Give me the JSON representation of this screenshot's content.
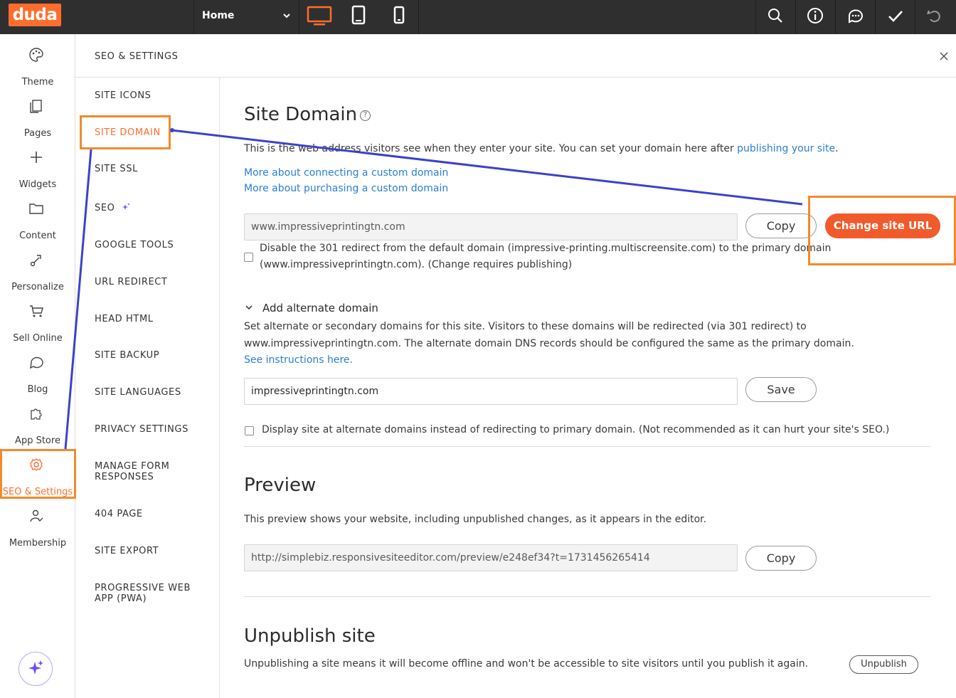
{
  "topbar": {
    "logo": "duda",
    "page_select": "Home",
    "devices": [
      "desktop-icon",
      "tablet-icon",
      "mobile-icon"
    ],
    "actions": [
      "search-icon",
      "info-icon",
      "comments-icon",
      "check-icon",
      "undo-icon"
    ],
    "accent": "#ff6d2d"
  },
  "rail": {
    "items": [
      {
        "label": "Theme",
        "icon": "palette-icon"
      },
      {
        "label": "Pages",
        "icon": "pages-icon"
      },
      {
        "label": "Widgets",
        "icon": "plus-icon"
      },
      {
        "label": "Content",
        "icon": "folder-icon"
      },
      {
        "label": "Personalize",
        "icon": "personalize-icon"
      },
      {
        "label": "Sell Online",
        "icon": "cart-icon"
      },
      {
        "label": "Blog",
        "icon": "chat-bubble-icon"
      },
      {
        "label": "App Store",
        "icon": "puzzle-icon"
      },
      {
        "label": "SEO & Settings",
        "icon": "gear-icon"
      },
      {
        "label": "Membership",
        "icon": "member-icon"
      }
    ],
    "active": "SEO & Settings"
  },
  "panel": {
    "title": "SEO & SETTINGS",
    "nav": [
      "SITE ICONS",
      "SITE DOMAIN",
      "SITE SSL",
      "SEO",
      "GOOGLE TOOLS",
      "URL REDIRECT",
      "HEAD HTML",
      "SITE BACKUP",
      "SITE LANGUAGES",
      "PRIVACY SETTINGS",
      "MANAGE FORM RESPONSES",
      "404 PAGE",
      "SITE EXPORT",
      "PROGRESSIVE WEB APP (PWA)"
    ],
    "active_nav": "SITE DOMAIN"
  },
  "site_domain": {
    "heading": "Site Domain",
    "help": "?",
    "desc": "This is the web address visitors see when they enter your site. You can set your domain here after ",
    "desc_link": "publishing your site",
    "desc_end": ".",
    "link_connect": "More about connecting a custom domain",
    "link_purchase": "More about purchasing a custom domain",
    "domain_value": "www.impressiveprintingtn.com",
    "copy_label": "Copy",
    "change_url_label": "Change site URL",
    "redirect_line1": "Disable the 301 redirect from the default domain (impressive-printing.multiscreensite.com) to the primary domain",
    "redirect_line2": "(www.impressiveprintingtn.com). (Change requires publishing)"
  },
  "alternate": {
    "toggle_label": "Add alternate domain",
    "line1": "Set alternate or secondary domains for this site. Visitors to these domains will be redirected (via 301 redirect) to",
    "line2": "www.impressiveprintingtn.com. The alternate domain DNS records should be configured the same as the primary domain.",
    "instructions_link": "See instructions here.",
    "input_value": "impressiveprintingtn.com",
    "save_label": "Save",
    "display_option": "Display site at alternate domains instead of redirecting to primary domain. (Not recommended as it can hurt your site's SEO.)"
  },
  "preview": {
    "heading": "Preview",
    "desc": "This preview shows your website, including unpublished changes, as it appears in the editor.",
    "url": "http://simplebiz.responsivesiteeditor.com/preview/e248ef34?t=1731456265414",
    "copy_label": "Copy"
  },
  "unpublish": {
    "heading": "Unpublish site",
    "desc": "Unpublishing a site means it will become offline and won't be accessible to site visitors until you publish it again.",
    "button_label": "Unpublish"
  },
  "annotation_colors": {
    "highlight": "#f28a2c",
    "arrow": "#3b43c9"
  }
}
